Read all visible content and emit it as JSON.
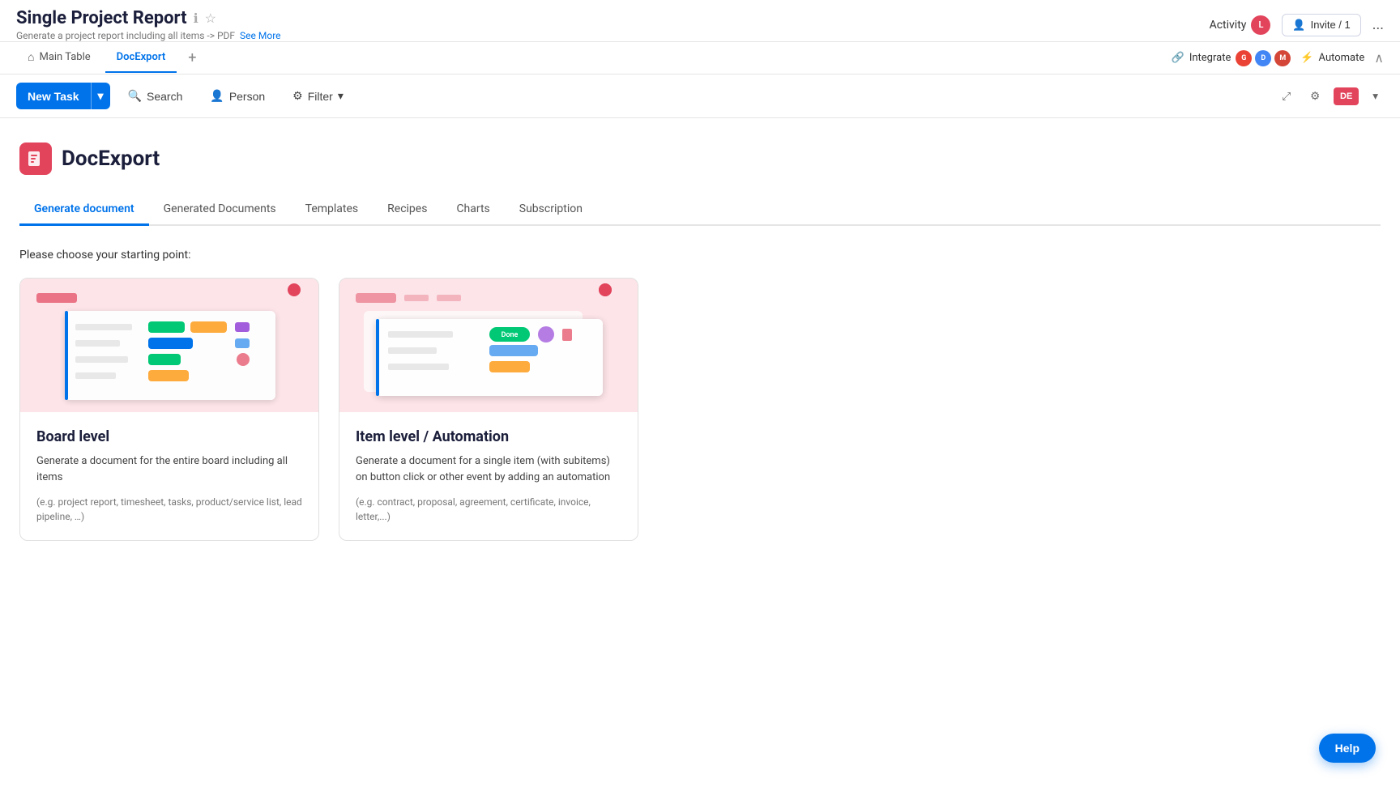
{
  "header": {
    "title": "Single Project Report",
    "subtitle": "Generate a project report including all items -> PDF",
    "see_more": "See More",
    "activity_label": "Activity",
    "activity_avatar": "L",
    "invite_label": "Invite / 1",
    "more_label": "..."
  },
  "tabs": [
    {
      "id": "main-table",
      "label": "Main Table",
      "icon": "home",
      "active": false
    },
    {
      "id": "docexport",
      "label": "DocExport",
      "active": true
    }
  ],
  "tab_bar_right": {
    "integrate_label": "Integrate",
    "automate_label": "Automate"
  },
  "toolbar": {
    "new_task_label": "New Task",
    "search_label": "Search",
    "person_label": "Person",
    "filter_label": "Filter"
  },
  "docexport": {
    "logo_text": "DE",
    "title": "DocExport",
    "inner_tabs": [
      {
        "id": "generate",
        "label": "Generate document",
        "active": true
      },
      {
        "id": "generated",
        "label": "Generated Documents",
        "active": false
      },
      {
        "id": "templates",
        "label": "Templates",
        "active": false
      },
      {
        "id": "recipes",
        "label": "Recipes",
        "active": false
      },
      {
        "id": "charts",
        "label": "Charts",
        "active": false
      },
      {
        "id": "subscription",
        "label": "Subscription",
        "active": false
      }
    ],
    "starting_point": "Please choose your starting point:",
    "cards": [
      {
        "id": "board-level",
        "title": "Board level",
        "description": "Generate a document for the entire board including all items",
        "examples": "(e.g. project report, timesheet, tasks, product/service list, lead pipeline, …)"
      },
      {
        "id": "item-level",
        "title": "Item level / Automation",
        "description": "Generate a document for a single item (with subitems) on button click or other event by adding an automation",
        "examples": "(e.g. contract, proposal, agreement, certificate, invoice, letter,...)"
      }
    ]
  },
  "help": {
    "label": "Help"
  }
}
